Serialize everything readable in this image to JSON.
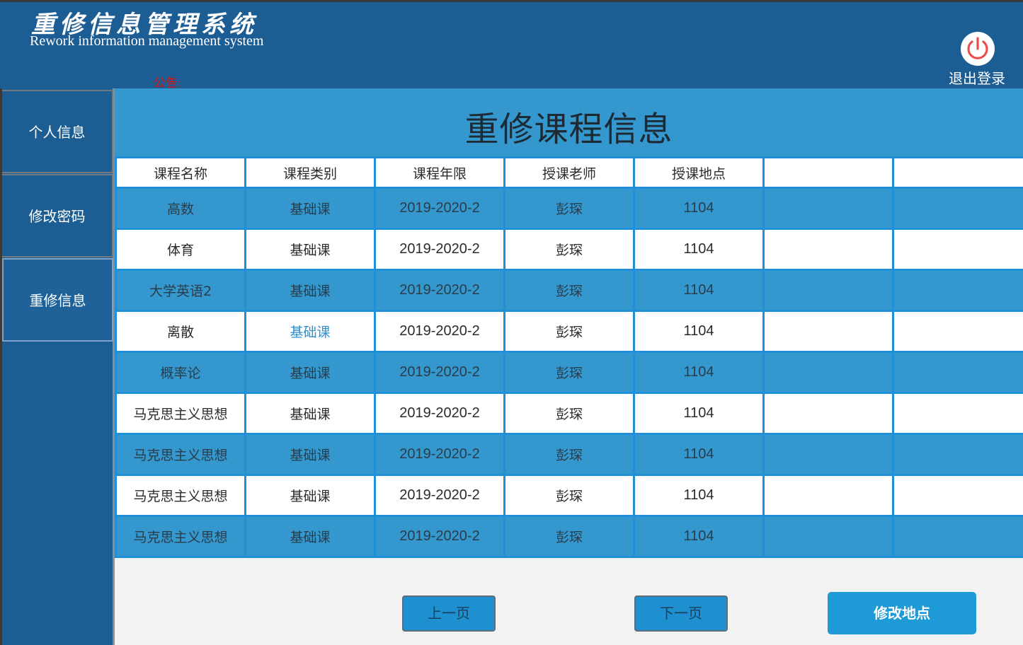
{
  "header": {
    "title_cn": "重修信息管理系统",
    "title_en": "Rework information management system",
    "notice_label": "公告:",
    "logout_label": "退出登录"
  },
  "sidebar": {
    "items": [
      {
        "label": "个人信息"
      },
      {
        "label": "修改密码"
      },
      {
        "label": "重修信息"
      }
    ],
    "active_index": 2
  },
  "main": {
    "title": "重修课程信息",
    "table": {
      "columns": [
        "课程名称",
        "课程类别",
        "课程年限",
        "授课老师",
        "授课地点",
        "",
        ""
      ],
      "rows": [
        [
          "高数",
          "基础课",
          "2019-2020-2",
          "彭琛",
          "1104",
          "",
          ""
        ],
        [
          "体育",
          "基础课",
          "2019-2020-2",
          "彭琛",
          "1104",
          "",
          ""
        ],
        [
          "大学英语2",
          "基础课",
          "2019-2020-2",
          "彭琛",
          "1104",
          "",
          ""
        ],
        [
          "离散",
          "基础课",
          "2019-2020-2",
          "彭琛",
          "1104",
          "",
          ""
        ],
        [
          "概率论",
          "基础课",
          "2019-2020-2",
          "彭琛",
          "1104",
          "",
          ""
        ],
        [
          "马克思主义思想",
          "基础课",
          "2019-2020-2",
          "彭琛",
          "1104",
          "",
          ""
        ],
        [
          "马克思主义思想",
          "基础课",
          "2019-2020-2",
          "彭琛",
          "1104",
          "",
          ""
        ],
        [
          "马克思主义思想",
          "基础课",
          "2019-2020-2",
          "彭琛",
          "1104",
          "",
          ""
        ],
        [
          "马克思主义思想",
          "基础课",
          "2019-2020-2",
          "彭琛",
          "1104",
          "",
          ""
        ]
      ]
    },
    "buttons": {
      "prev": "上一页",
      "next": "下一页",
      "edit_location": "修改地点"
    }
  },
  "colors": {
    "header_bg": "#1c5e94",
    "title_band": "#3497cd",
    "grid_line": "#1f8fd8",
    "button": "#1e9ad6",
    "notice": "#e01010"
  },
  "icons": {
    "logout": "power-icon"
  }
}
